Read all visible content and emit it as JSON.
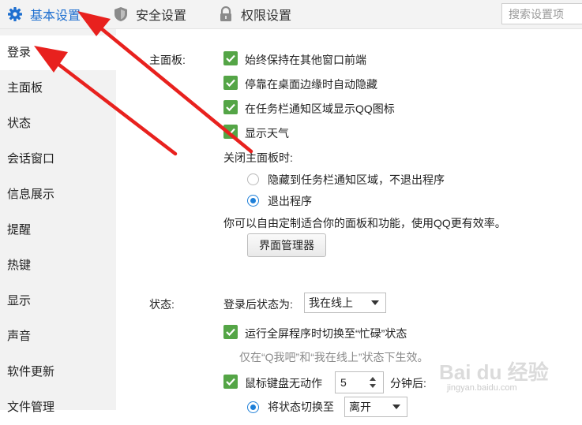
{
  "tabs": [
    {
      "label": "基本设置",
      "icon": "gear-icon",
      "active": true
    },
    {
      "label": "安全设置",
      "icon": "shield-icon",
      "active": false
    },
    {
      "label": "权限设置",
      "icon": "lock-icon",
      "active": false
    }
  ],
  "search": {
    "placeholder": "搜索设置项"
  },
  "sidebar": {
    "items": [
      {
        "label": "登录"
      },
      {
        "label": "主面板"
      },
      {
        "label": "状态"
      },
      {
        "label": "会话窗口"
      },
      {
        "label": "信息展示"
      },
      {
        "label": "提醒"
      },
      {
        "label": "热键"
      },
      {
        "label": "显示"
      },
      {
        "label": "声音"
      },
      {
        "label": "软件更新"
      },
      {
        "label": "文件管理"
      }
    ]
  },
  "main_panel": {
    "section_label": "主面板:",
    "checkboxes": [
      {
        "label": "始终保持在其他窗口前端",
        "checked": true
      },
      {
        "label": "停靠在桌面边缘时自动隐藏",
        "checked": true
      },
      {
        "label": "在任务栏通知区域显示QQ图标",
        "checked": true
      },
      {
        "label": "显示天气",
        "checked": true
      }
    ],
    "close_label": "关闭主面板时:",
    "radios": [
      {
        "label": "隐藏到任务栏通知区域，不退出程序",
        "selected": false
      },
      {
        "label": "退出程序",
        "selected": true
      }
    ],
    "custom_text": "你可以自由定制适合你的面板和功能，使用QQ更有效率。",
    "manager_button": "界面管理器"
  },
  "status": {
    "section_label": "状态:",
    "after_login_label": "登录后状态为:",
    "after_login_value": "我在线上",
    "fullscreen_label": "运行全屏程序时切换至“忙碌”状态",
    "fullscreen_checked": true,
    "fullscreen_hint": "仅在“Q我吧”和“我在线上”状态下生效。",
    "idle_label": "鼠标键盘无动作",
    "idle_checked": true,
    "idle_minutes": "5",
    "idle_unit": "分钟后:",
    "switch_label": "将状态切换至",
    "switch_value": "离开",
    "switch_selected": true
  },
  "watermark": {
    "text": "Bai du 经验",
    "sub": "jingyan.baidu.com"
  },
  "colors": {
    "accent": "#1e6fd0",
    "check": "#54a546",
    "arrow": "#e8211e"
  }
}
